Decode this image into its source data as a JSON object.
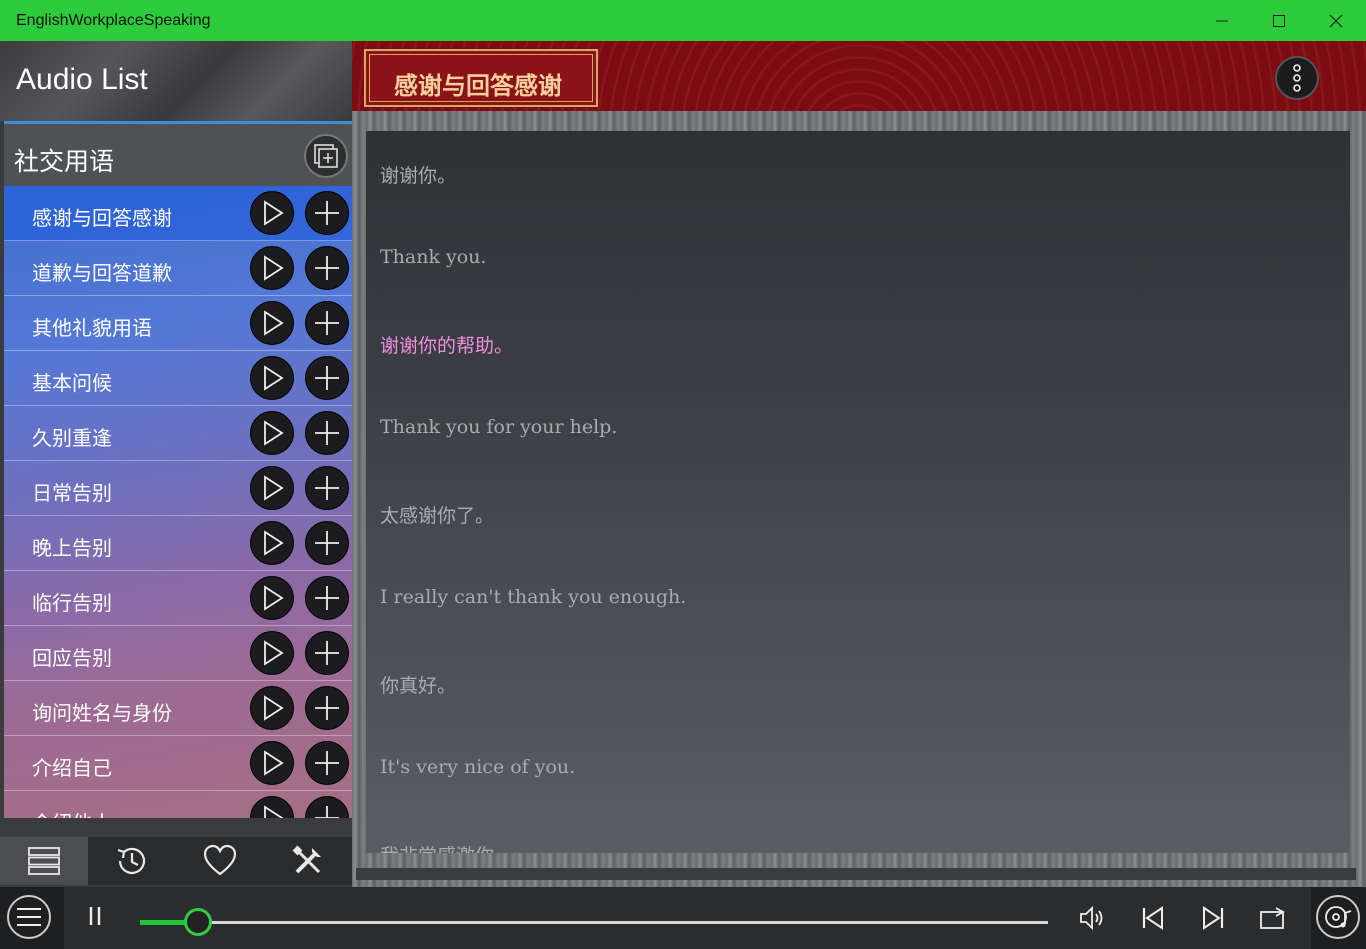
{
  "window": {
    "title": "EnglishWorkplaceSpeaking"
  },
  "sidebar": {
    "header_title": "Audio List",
    "group_title": "社交用语",
    "items": [
      {
        "label": "感谢与回答感谢"
      },
      {
        "label": "道歉与回答道歉"
      },
      {
        "label": "其他礼貌用语"
      },
      {
        "label": "基本问候"
      },
      {
        "label": "久别重逢"
      },
      {
        "label": "日常告别"
      },
      {
        "label": "晚上告别"
      },
      {
        "label": "临行告别"
      },
      {
        "label": "回应告别"
      },
      {
        "label": "询问姓名与身份"
      },
      {
        "label": "介绍自己"
      },
      {
        "label": "介绍他人"
      }
    ],
    "active_index": 0,
    "tabs": [
      "list-icon",
      "history-icon",
      "heart-icon",
      "tools-icon"
    ]
  },
  "content": {
    "title": "感谢与回答感谢",
    "lyrics": [
      {
        "text": "谢谢你。",
        "current": false
      },
      {
        "text": "Thank you.",
        "current": false
      },
      {
        "text": "谢谢你的帮助。",
        "current": true
      },
      {
        "text": "Thank you for your help.",
        "current": false
      },
      {
        "text": "太感谢你了。",
        "current": false
      },
      {
        "text": "I really can't thank you enough.",
        "current": false
      },
      {
        "text": "你真好。",
        "current": false
      },
      {
        "text": "It's very nice of you.",
        "current": false
      },
      {
        "text": "我非常感激你",
        "current": false
      }
    ]
  },
  "player": {
    "progress": 0.064,
    "controls": [
      "pause-icon",
      "volume-icon",
      "previous-icon",
      "next-icon",
      "repeat-icon",
      "disc-music-icon"
    ]
  },
  "colors": {
    "titlebar": "#2ccc3c",
    "accent_green": "#22c43a",
    "banner_red": "#7d0f14",
    "banner_gold": "#f6cf9a",
    "current_lyric": "#ee8fe0"
  }
}
